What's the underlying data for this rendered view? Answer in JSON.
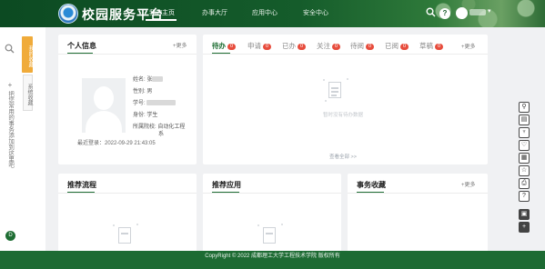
{
  "header": {
    "app_title": "校园服务平台",
    "nav": [
      {
        "label": "我的主页",
        "active": true
      },
      {
        "label": "办事大厅",
        "active": false
      },
      {
        "label": "应用中心",
        "active": false
      },
      {
        "label": "安全中心",
        "active": false
      }
    ],
    "user_name_initial": "张",
    "help_glyph": "?",
    "caret": "▾"
  },
  "sidebar": {
    "favorites_tab": "我的收藏",
    "system_favorites_tab": "系统收藏",
    "hint_plus": "+",
    "hint_text": "把您常用的事务添加到这里吧",
    "bottom_badge": "D"
  },
  "profile_card": {
    "title": "个人信息",
    "more": "+更多",
    "fields": [
      {
        "label": "姓名:",
        "value": "张"
      },
      {
        "label": "性别:",
        "value": "男"
      },
      {
        "label": "学号:",
        "value": ""
      },
      {
        "label": "身份:",
        "value": "学生"
      }
    ],
    "dept_label": "所属院校:",
    "dept_value_line1": "自动化工程",
    "dept_value_line2": "系",
    "last_login": "最近登录：2022-09-29 21:43:05"
  },
  "todo_card": {
    "tabs": [
      {
        "label": "待办",
        "count": "0",
        "active": true
      },
      {
        "label": "申请",
        "count": "0",
        "active": false
      },
      {
        "label": "已办",
        "count": "0",
        "active": false
      },
      {
        "label": "关注",
        "count": "0",
        "active": false
      },
      {
        "label": "待阅",
        "count": "0",
        "active": false
      },
      {
        "label": "已阅",
        "count": "0",
        "active": false
      },
      {
        "label": "草稿",
        "count": "0",
        "active": false
      }
    ],
    "more": "+更多",
    "empty_text": "暂时没有待办数据",
    "view_all": "查看全部 >>"
  },
  "recommend_flow": {
    "title": "推荐流程"
  },
  "recommend_apps": {
    "title": "推荐应用"
  },
  "favorites": {
    "title": "事务收藏",
    "more": "+更多"
  },
  "right_toolbar": {
    "icons": [
      "user-icon",
      "document-icon",
      "shirt-icon",
      "heart-icon",
      "report-icon",
      "star-icon",
      "printer-icon",
      "help-icon",
      "grid-icon",
      "add-icon"
    ],
    "glyphs": [
      "⚲",
      "▤",
      "♆",
      "♡",
      "▦",
      "☆",
      "⎙",
      "?",
      "▣",
      "+"
    ]
  },
  "footer": {
    "copyright": "CopyRight © 2022 成都理工大学工程技术学院 版权所有"
  },
  "colors": {
    "brand_green": "#1f6e34",
    "header_dark": "#0c4a22",
    "favorite_tab": "#f0ab3a",
    "badge_red": "#e74c3c"
  }
}
